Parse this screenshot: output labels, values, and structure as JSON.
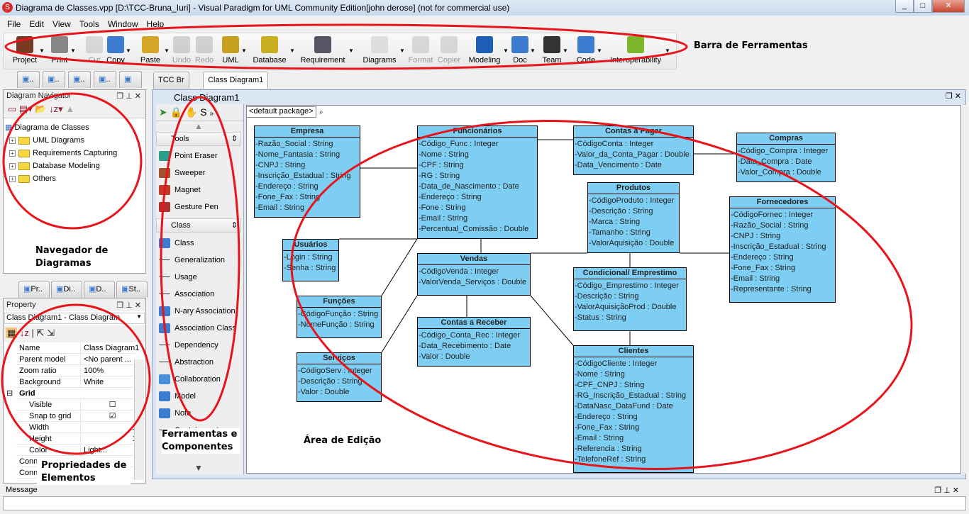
{
  "window": {
    "title": "Diagrama de Classes.vpp [D:\\TCC-Bruna_Iuri] - Visual Paradigm for UML Community Edition[john derose] (not for commercial use)"
  },
  "menu": [
    "File",
    "Edit",
    "View",
    "Tools",
    "Window",
    "Help"
  ],
  "toolbar": [
    {
      "label": "Project",
      "enabled": true,
      "dropdown": true
    },
    {
      "label": "Print",
      "enabled": true,
      "dropdown": true
    },
    {
      "label": "Cut",
      "enabled": false
    },
    {
      "label": "Copy",
      "enabled": true,
      "dropdown": true
    },
    {
      "label": "Paste",
      "enabled": true,
      "dropdown": true
    },
    {
      "label": "Undo",
      "enabled": false
    },
    {
      "label": "Redo",
      "enabled": false
    },
    {
      "label": "UML",
      "enabled": true,
      "dropdown": true
    },
    {
      "label": "Database",
      "enabled": true,
      "dropdown": true
    },
    {
      "label": "Requirement",
      "enabled": true,
      "dropdown": true
    },
    {
      "label": "Diagrams",
      "enabled": true,
      "dropdown": true
    },
    {
      "label": "Format",
      "enabled": false
    },
    {
      "label": "Copier",
      "enabled": false
    },
    {
      "label": "Modeling",
      "enabled": true,
      "dropdown": true
    },
    {
      "label": "Doc",
      "enabled": true,
      "dropdown": true
    },
    {
      "label": "Team",
      "enabled": true,
      "dropdown": true
    },
    {
      "label": "Code",
      "enabled": true,
      "dropdown": true
    },
    {
      "label": "Interoperability",
      "enabled": true,
      "dropdown": true
    }
  ],
  "annotations": {
    "toolbar": "Barra de Ferramentas",
    "navigator_1": "Navegador de",
    "navigator_2": "Diagramas",
    "properties_1": "Propriedades de",
    "properties_2": "Elementos",
    "tools_1": "Ferramentas e",
    "tools_2": "Componentes",
    "editor": "Área de Edição"
  },
  "left_tabs_top": [
    "..",
    "..",
    "..",
    "..",
    ""
  ],
  "navigator": {
    "title": "Diagram Navigator",
    "root": "Diagrama de Classes",
    "items": [
      "UML Diagrams",
      "Requirements Capturing",
      "Database Modeling",
      "Others"
    ]
  },
  "left_tabs_bottom": [
    "Pr..",
    "Di..",
    "D..",
    "St.."
  ],
  "property": {
    "title": "Property",
    "selector": "Class Diagram1 - Class Diagram",
    "rows": [
      {
        "key": "Name",
        "value": "Class Diagram1"
      },
      {
        "key": "Parent model",
        "value": "<No parent ..."
      },
      {
        "key": "Zoom ratio",
        "value": "100%"
      },
      {
        "key": "Background",
        "value": "White"
      },
      {
        "key": "Grid",
        "value": ""
      },
      {
        "key": "Visible",
        "value": "",
        "checked": false
      },
      {
        "key": "Snap to grid",
        "value": "",
        "checked": true
      },
      {
        "key": "Width",
        "value": "10"
      },
      {
        "key": "Height",
        "value": "10"
      },
      {
        "key": "Color",
        "value": "Light..."
      },
      {
        "key": "Conne",
        "value": ""
      },
      {
        "key": "Conne",
        "value": ""
      }
    ]
  },
  "doc_tabs": [
    "TCC Br",
    "Class Diagram1"
  ],
  "diagram": {
    "title": "Class Diagram1",
    "package": "<default package>",
    "tool_groups": {
      "tools": {
        "label": "Tools",
        "items": [
          "Point Eraser",
          "Sweeper",
          "Magnet",
          "Gesture Pen"
        ]
      },
      "class": {
        "label": "Class",
        "items": [
          "Class",
          "Generalization",
          "Usage",
          "Association",
          "N-ary Association",
          "Association Class",
          "Dependency",
          "Abstraction",
          "Collaboration",
          "Model",
          "Note",
          "Containment"
        ]
      }
    },
    "classes": [
      {
        "name": "Empresa",
        "attrs": [
          "-Razão_Social : String",
          "-Nome_Fantasia : String",
          "-CNPJ : String",
          "-Inscrição_Estadual : String",
          "-Endereço : String",
          "-Fone_Fax : String",
          "-Email : String"
        ]
      },
      {
        "name": "Funcionários",
        "attrs": [
          "-Código_Func : Integer",
          "-Nome : String",
          "-CPF : String",
          "-RG : String",
          "-Data_de_Nascimento : Date",
          "-Endereço : String",
          "-Fone : String",
          "-Email : String",
          "-Percentual_Comissão : Double"
        ]
      },
      {
        "name": "Contas a Pagar",
        "attrs": [
          "-CódigoConta : Integer",
          "-Valor_da_Conta_Pagar : Double",
          "-Data_Vencimento : Date"
        ]
      },
      {
        "name": "Compras",
        "attrs": [
          "-Código_Compra : Integer",
          "-Data_Compra : Date",
          "-Valor_Compra : Double"
        ]
      },
      {
        "name": "Produtos",
        "attrs": [
          "-CódigoProduto : Integer",
          "-Descrição : String",
          "-Marca : String",
          "-Tamanho : String",
          "-ValorAquisição : Double"
        ]
      },
      {
        "name": "Fornecedores",
        "attrs": [
          "-CódigoFornec : Integer",
          "-Razão_Social : String",
          "-CNPJ : String",
          "-Inscrição_Estadual : String",
          "-Endereço : String",
          "-Fone_Fax : String",
          "-Email : String",
          "-Representante : String"
        ]
      },
      {
        "name": "Usuários",
        "attrs": [
          "-Login : String",
          "-Senha : String"
        ]
      },
      {
        "name": "Vendas",
        "attrs": [
          "-CódigoVenda : Integer",
          "-ValorVenda_Serviços : Double"
        ]
      },
      {
        "name": "Condicional/ Emprestimo",
        "attrs": [
          "-Código_Emprestimo : Integer",
          "-Descrição : String",
          "-ValorAquisiçãoProd : Double",
          "-Status : String"
        ]
      },
      {
        "name": "Funções",
        "attrs": [
          "-CódigoFunção : String",
          "-NomeFunção : String"
        ]
      },
      {
        "name": "Contas a Receber",
        "attrs": [
          "-Código_Conta_Rec : Integer",
          "-Data_Recebimento : Date",
          "-Valor : Double"
        ]
      },
      {
        "name": "Serviços",
        "attrs": [
          "-CódigoServ : Integer",
          "-Descrição : String",
          "-Valor : Double"
        ]
      },
      {
        "name": "Clientes",
        "attrs": [
          "-CódigoCliente : Integer",
          "-Nome : String",
          "-CPF_CNPJ : String",
          "-RG_Inscrição_Estadual : String",
          "-DataNasc_DataFund : Date",
          "-Endereço : String",
          "-Fone_Fax : String",
          "-Email : String",
          "-Referencia : String",
          "-TelefoneRef : String"
        ]
      }
    ],
    "associations": [
      [
        "Empresa",
        "Funcionários"
      ],
      [
        "Funcionários",
        "Contas a Pagar"
      ],
      [
        "Contas a Pagar",
        "Compras"
      ],
      [
        "Usuários",
        "Funcionários"
      ],
      [
        "Funcionários",
        "Funções"
      ],
      [
        "Funcionários",
        "Vendas"
      ],
      [
        "Vendas",
        "Produtos"
      ],
      [
        "Produtos",
        "Fornecedores"
      ],
      [
        "Produtos",
        "Condicional/ Emprestimo"
      ],
      [
        "Vendas",
        "Contas a Receber"
      ],
      [
        "Vendas",
        "Serviços"
      ],
      [
        "Vendas",
        "Clientes"
      ],
      [
        "Condicional/ Emprestimo",
        "Clientes"
      ]
    ]
  },
  "message": {
    "title": "Message"
  },
  "colors": {
    "class_fill": "#7ecef4",
    "annotation_stroke": "#e8141c"
  }
}
